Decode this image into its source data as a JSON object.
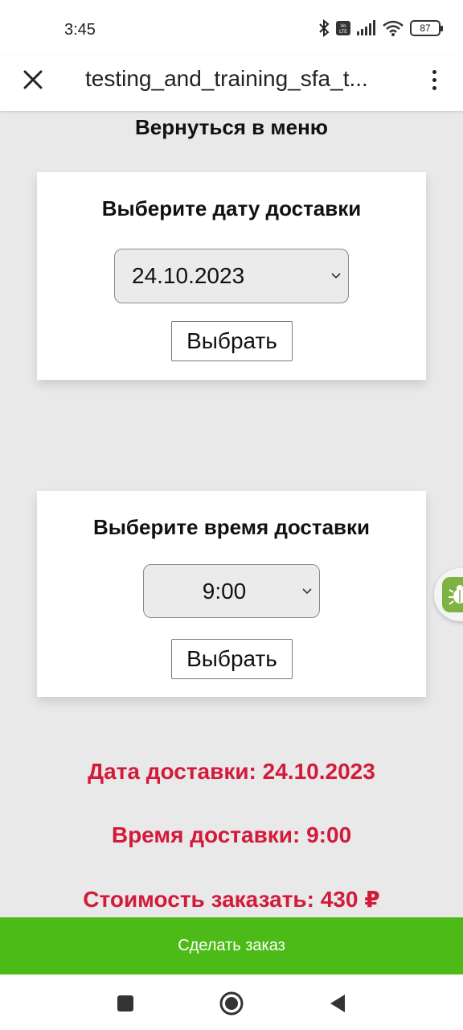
{
  "status_bar": {
    "time": "3:45",
    "battery": "87"
  },
  "app_bar": {
    "title": "testing_and_training_sfa_t..."
  },
  "page": {
    "back_label": "Вернуться в меню"
  },
  "date_card": {
    "title": "Выберите дату доставки",
    "selected": "24.10.2023",
    "button_label": "Выбрать"
  },
  "time_card": {
    "title": "Выберите время доставки",
    "selected": "9:00",
    "button_label": "Выбрать"
  },
  "summary": {
    "date": "Дата доставки: 24.10.2023",
    "time": "Время доставки: 9:00",
    "cost": "Стоимость заказать: 430 ₽"
  },
  "order": {
    "button_label": "Сделать заказ"
  },
  "colors": {
    "accent_green": "#4cbb17",
    "summary_red": "#d41a3a"
  },
  "icons": [
    "close-icon",
    "more-vert-icon",
    "chevron-down-icon",
    "bluetooth-icon",
    "volte-icon",
    "signal-icon",
    "wifi-icon",
    "battery-icon",
    "dr-web-bug-icon",
    "nav-square-icon",
    "nav-circle-icon",
    "nav-back-icon"
  ]
}
